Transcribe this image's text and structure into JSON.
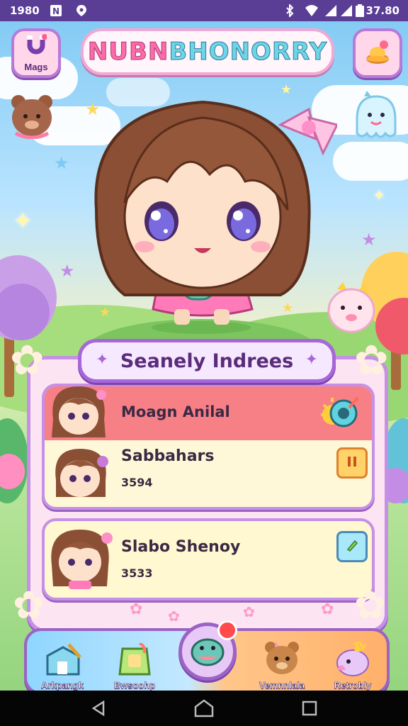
{
  "status_bar": {
    "time": "1980",
    "clock": "37.80"
  },
  "header": {
    "left_button_label": "Mags",
    "logo_part1": "NUBN ",
    "logo_part2": "BHONORRY"
  },
  "panel": {
    "title": "Seanely Indrees",
    "cards": [
      {
        "header_label": "Moagn Anilal"
      },
      {
        "name": "Sabbahars",
        "number": "3594"
      },
      {
        "name": "Slabo Shenoy",
        "number": "3533"
      }
    ]
  },
  "bottom_nav": {
    "items": [
      {
        "label": "Arkpangk"
      },
      {
        "label": "Bwsoohp"
      },
      {
        "label": "Vemnnlala"
      },
      {
        "label": "Retrobly"
      }
    ]
  },
  "colors": {
    "status_bar": "#5a3e96",
    "accent_purple": "#9b63c4",
    "card_header": "#f77f86",
    "card_body": "#fff8d8",
    "logo_pink": "#ff6aa8",
    "logo_cyan": "#6fd4e8"
  },
  "icons": [
    "notification-icon",
    "location-icon",
    "bluetooth-icon",
    "wifi-icon",
    "signal-icon",
    "battery-icon",
    "magnet-icon",
    "treasure-icon",
    "pause-icon",
    "edit-icon",
    "back-icon",
    "home-icon",
    "recents-icon"
  ]
}
